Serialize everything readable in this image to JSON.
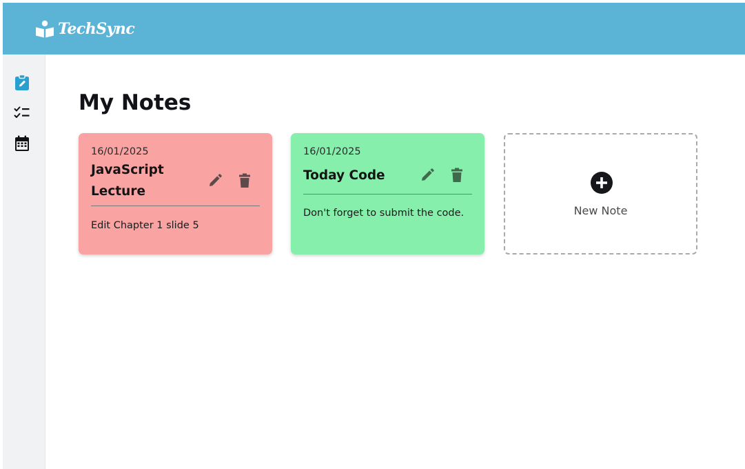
{
  "app": {
    "name": "TechSync",
    "brand_color": "#5bb4d6",
    "logo_icon": "reader-icon"
  },
  "sidebar": {
    "items": [
      {
        "name": "notes",
        "icon": "clipboard-edit-icon",
        "active": true,
        "color": "#2aa0d0"
      },
      {
        "name": "tasks",
        "icon": "checklist-icon",
        "active": false,
        "color": "#111111"
      },
      {
        "name": "calendar",
        "icon": "calendar-icon",
        "active": false,
        "color": "#111111"
      }
    ]
  },
  "main": {
    "title": "My Notes",
    "notes": [
      {
        "date": "16/01/2025",
        "title": "JavaScript Lecture",
        "body": "Edit Chapter 1 slide 5",
        "color": "#f9a3a3",
        "edit_icon": "pencil-icon",
        "delete_icon": "trash-icon"
      },
      {
        "date": "16/01/2025",
        "title": "Today Code",
        "body": "Don't forget to submit the code.",
        "color": "#86efac",
        "edit_icon": "pencil-icon",
        "delete_icon": "trash-icon"
      }
    ],
    "new_note": {
      "label": "New Note",
      "icon": "plus-circle-icon"
    }
  }
}
